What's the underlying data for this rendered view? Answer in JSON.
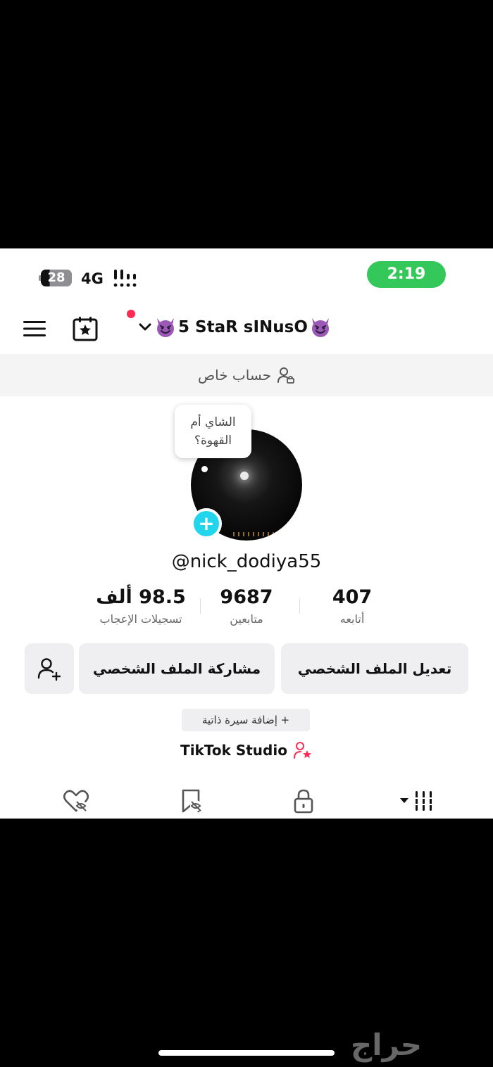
{
  "status_bar": {
    "battery": "28",
    "battery_level": 0.28,
    "network": "4G",
    "time": "2:19"
  },
  "top_bar": {
    "account_name": "5 StaR sINusO",
    "left_emoji_icon": "smiling-devil-icon",
    "right_emoji_icon": "smiling-devil-icon",
    "notification_dot_color": "#fe2c55"
  },
  "private_banner": {
    "label": "حساب خاص"
  },
  "profile": {
    "bubble_text": "الشاي أم القهوة؟",
    "username": "@nick_dodiya55"
  },
  "stats": [
    {
      "value": "407",
      "label": "أتابعه"
    },
    {
      "value": "9687",
      "label": "متابعين"
    },
    {
      "value": "98.5 ألف",
      "label": "تسجيلات الإعجاب"
    }
  ],
  "buttons": {
    "edit_profile": "تعديل الملف الشخصي",
    "share_profile": "مشاركة الملف الشخصي"
  },
  "bio": {
    "add_bio": "+ إضافة سيرة ذاتية"
  },
  "studio": {
    "label": "TikTok Studio"
  },
  "tabs": [
    {
      "icon": "grid-icon"
    },
    {
      "icon": "lock-icon"
    },
    {
      "icon": "bookmark-hidden-icon"
    },
    {
      "icon": "liked-hidden-icon"
    }
  ],
  "watermark": "حراج",
  "colors": {
    "accent_red": "#fe2c55",
    "avatar_add": "#20d5ec",
    "clock_green": "#34c759"
  }
}
